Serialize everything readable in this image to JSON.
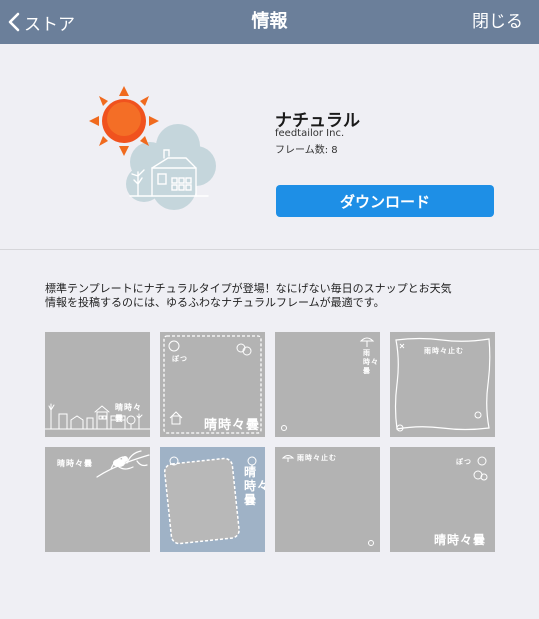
{
  "nav": {
    "back_label": "ストア",
    "title": "情報",
    "close_label": "閉じる"
  },
  "app": {
    "name": "ナチュラル",
    "vendor": "feedtailor Inc.",
    "frame_count": "フレーム数: 8",
    "download_label": "ダウンロード"
  },
  "description": {
    "line1": "標準テンプレートにナチュラルタイプが登場！なにげない毎日のスナップとお天気",
    "line2": "情報を投稿するのには、ゆるふわなナチュラルフレームが最適です。"
  },
  "thumbnails": {
    "t1": "晴時々曇",
    "t2a": "ぽつ",
    "t2b": "晴時々曇",
    "t3": "雨時々曇",
    "t4": "雨時々止む",
    "t5": "晴時々曇",
    "t6": "晴時々曇",
    "t7": "雨時々止む",
    "t8a": "ぽつ",
    "t8b": "晴時々曇"
  },
  "colors": {
    "navbar": "#6b7f9a",
    "button": "#1e8fe6",
    "thumb_gray": "#b3b3b3",
    "thumb_blue": "#9fb2c6"
  }
}
